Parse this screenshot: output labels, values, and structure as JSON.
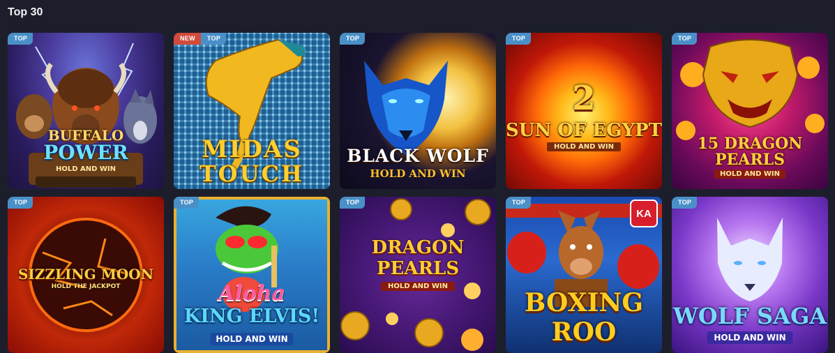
{
  "section": {
    "title": "Top 30"
  },
  "games": [
    {
      "name": "Buffalo Power",
      "line1": "BUFFALO",
      "line2": "POWER",
      "sub": "HOLD AND WIN",
      "badges": [
        "TOP"
      ]
    },
    {
      "name": "Midas Touch",
      "line1": "MIDAS",
      "line2": "TOUCH",
      "sub": "",
      "badges": [
        "NEW",
        "TOP"
      ]
    },
    {
      "name": "Black Wolf",
      "line1": "BLACK WOLF",
      "line2": "",
      "sub": "HOLD AND WIN",
      "badges": [
        "TOP"
      ]
    },
    {
      "name": "Sun of Egypt 2",
      "line1": "2",
      "line2": "SUN OF EGYPT",
      "sub": "HOLD AND WIN",
      "badges": [
        "TOP"
      ]
    },
    {
      "name": "15 Dragon Pearls",
      "line1": "15 DRAGON",
      "line2": "PEARLS",
      "sub": "HOLD AND WIN",
      "badges": [
        "TOP"
      ]
    },
    {
      "name": "Sizzling Moon",
      "line1": "SIZZLING MOON",
      "line2": "",
      "sub": "HOLD THE JACKPOT",
      "badges": [
        "TOP"
      ]
    },
    {
      "name": "Aloha King Elvis",
      "line1": "Aloha",
      "line2": "KING ELVIS!",
      "sub": "HOLD AND WIN",
      "badges": [
        "TOP"
      ]
    },
    {
      "name": "Dragon Pearls",
      "line1": "DRAGON",
      "line2": "PEARLS",
      "sub": "HOLD AND WIN",
      "badges": [
        "TOP"
      ]
    },
    {
      "name": "Boxing Roo",
      "line1": "BOXING",
      "line2": "ROO",
      "sub": "",
      "badges": [
        "TOP"
      ],
      "provider": "KA"
    },
    {
      "name": "Wolf Saga",
      "line1": "WOLF SAGA",
      "line2": "",
      "sub": "HOLD AND WIN",
      "badges": [
        "TOP"
      ]
    }
  ]
}
